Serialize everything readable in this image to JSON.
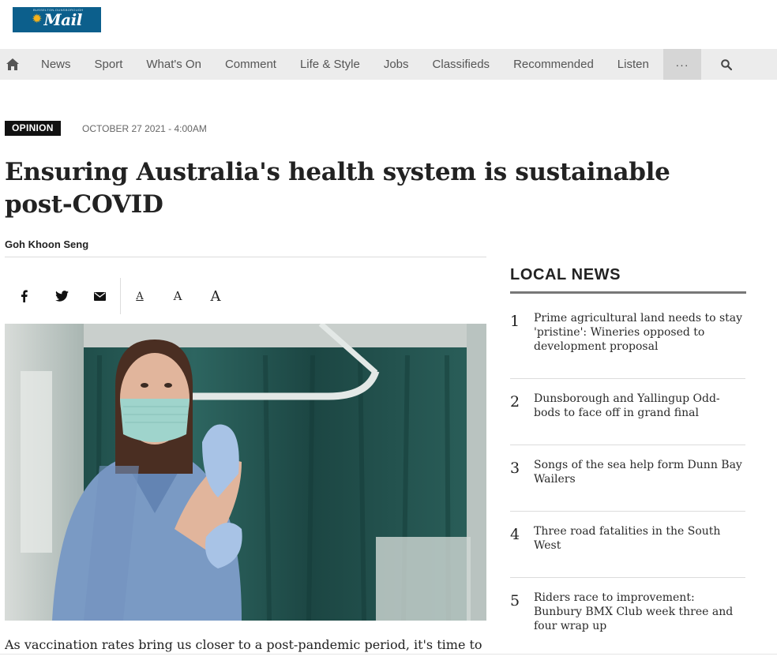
{
  "header": {
    "logo_text": "Mail",
    "logo_tagline": "BUSSELTON-DUNSBOROUGH"
  },
  "nav": {
    "items": [
      "News",
      "Sport",
      "What's On",
      "Comment",
      "Life & Style",
      "Jobs",
      "Classifieds",
      "Recommended",
      "Listen"
    ],
    "more_label": "···",
    "home_icon": "home-icon",
    "search_icon": "search-icon"
  },
  "article": {
    "category": "OPINION",
    "date": "OCTOBER 27 2021 - 4:00AM",
    "headline": "Ensuring Australia's health system is sustainable post-COVID",
    "author": "Goh Khoon Seng",
    "lede": "As vaccination rates bring us closer to a post-pandemic period, it's time to",
    "font_sizes": [
      "A",
      "A",
      "A"
    ]
  },
  "sidebar": {
    "title": "LOCAL NEWS",
    "stories": [
      {
        "num": "1",
        "title": "Prime agricultural land needs to stay 'pristine': Wineries opposed to development proposal"
      },
      {
        "num": "2",
        "title": "Dunsborough and Yallingup Odd-bods to face off in grand final"
      },
      {
        "num": "3",
        "title": "Songs of the sea help form Dunn Bay Wailers"
      },
      {
        "num": "4",
        "title": "Three road fatalities in the South West"
      },
      {
        "num": "5",
        "title": "Riders race to improvement: Bunbury BMX Club week three and four wrap up"
      }
    ]
  },
  "colors": {
    "logo_bg": "#0c5f8c",
    "nav_bg": "#ececec",
    "badge_bg": "#111111"
  }
}
